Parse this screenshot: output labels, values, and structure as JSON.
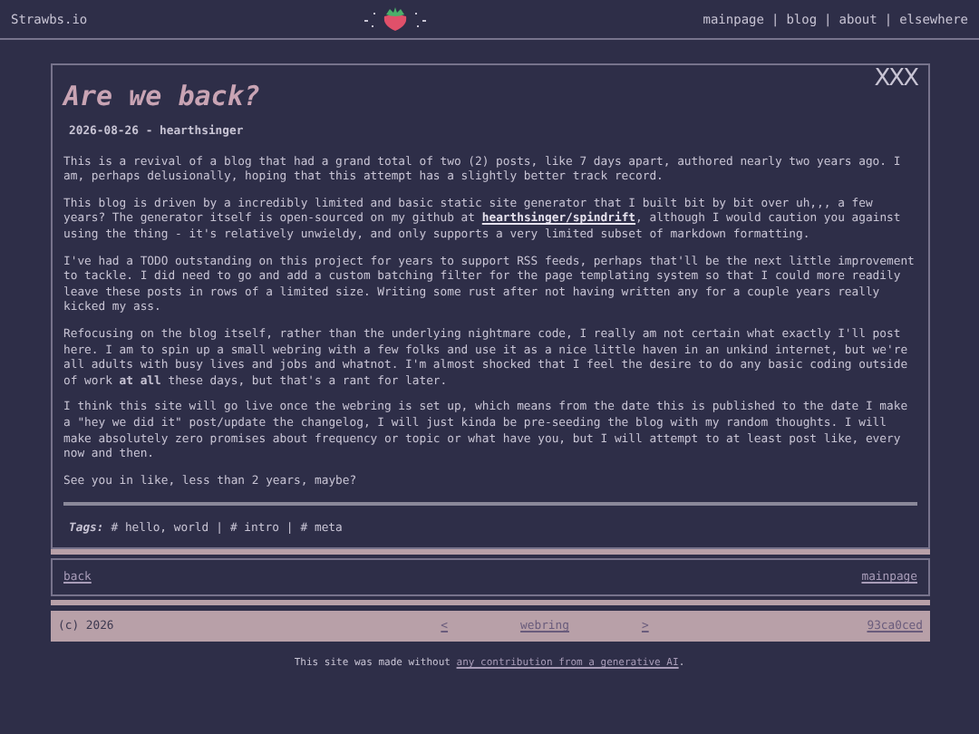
{
  "header": {
    "site_name": "Strawbs.io",
    "separator": "|",
    "nav": [
      {
        "label": "mainpage"
      },
      {
        "label": "blog"
      },
      {
        "label": "about"
      },
      {
        "label": "elsewhere"
      }
    ]
  },
  "post": {
    "title": "Are we back?",
    "mark": "XXX",
    "byline": "2026-08-26 - hearthsinger",
    "paragraphs": [
      {
        "text": "This is a revival of a blog that had a grand total of two (2) posts, like 7 days apart, authored nearly two years ago. I am, perhaps delusionally, hoping that this attempt has a slightly better track record."
      },
      {
        "text": "This blog is driven by a incredibly limited and basic static site generator that I built bit by bit over uh,,, a few years? The generator itself is open-sourced on my github at",
        "link": "hearthsinger/spindrift",
        "after": ", although I would caution you against using the thing - it's relatively unwieldy, and only supports a very limited subset of markdown formatting."
      },
      {
        "text": "I've had a TODO outstanding on this project for years to support RSS feeds, perhaps that'll be the next little improvement to tackle. I did need to go and add a custom batching filter for the page templating system so that I could more readily leave these posts in rows of a limited size. Writing some rust after not having written any for a couple years really kicked my ass."
      },
      {
        "text": "Refocusing on the blog itself, rather than the underlying nightmare code, I really am not certain what exactly I'll post here. I am to spin up a small webring with a few folks and use it as a nice little haven in an unkind internet, but we're all adults with busy lives and jobs and whatnot. I'm almost shocked that I feel the desire to do any basic coding outside of work **at all** these days, but that's a rant for later."
      },
      {
        "text": "I think this site will go live once the webring is set up, which means from the date this is published to the date I make a \"hey we did it\" post/update the changelog, I will just kinda be pre-seeding the blog with my random thoughts. I will make absolutely zero promises about frequency or topic or what have you, but I will attempt to at least post like, every now and then."
      },
      {
        "text": "See you in like, less than 2 years, maybe?"
      }
    ],
    "tags_label": "Tags:",
    "tag_separator": "|",
    "tags": [
      "# hello, world",
      "# intro",
      "# meta"
    ]
  },
  "nav": {
    "back": "back",
    "mainpage": "mainpage"
  },
  "footer": {
    "copyright": "(c) 2026",
    "prev": "<",
    "webring": "webring",
    "next": ">",
    "hash": "93ca0ced"
  },
  "note": {
    "text": "This site was made without",
    "link": "any contribution from a generative AI",
    "after": "."
  }
}
